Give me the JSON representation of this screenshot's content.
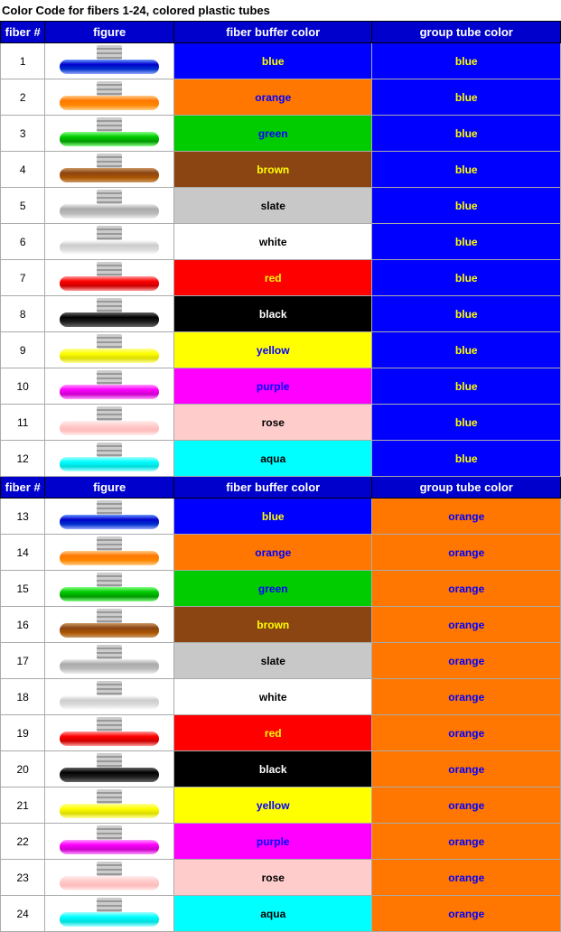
{
  "title": "Color Code for fibers 1-24, colored plastic tubes",
  "headers": {
    "fiber": "fiber #",
    "figure": "figure",
    "buffer": "fiber buffer color",
    "group": "group tube color"
  },
  "fibers": [
    {
      "num": 1,
      "figClass": "fig-blue",
      "bufferLabel": "blue",
      "bufferClass": "bg-blue",
      "groupLabel": "blue",
      "groupClass": "group-blue"
    },
    {
      "num": 2,
      "figClass": "fig-orange",
      "bufferLabel": "orange",
      "bufferClass": "bg-orange",
      "groupLabel": "blue",
      "groupClass": "group-blue"
    },
    {
      "num": 3,
      "figClass": "fig-green",
      "bufferLabel": "green",
      "bufferClass": "bg-green",
      "groupLabel": "blue",
      "groupClass": "group-blue"
    },
    {
      "num": 4,
      "figClass": "fig-brown",
      "bufferLabel": "brown",
      "bufferClass": "bg-brown",
      "groupLabel": "blue",
      "groupClass": "group-blue"
    },
    {
      "num": 5,
      "figClass": "fig-slate",
      "bufferLabel": "slate",
      "bufferClass": "bg-slate",
      "groupLabel": "blue",
      "groupClass": "group-blue"
    },
    {
      "num": 6,
      "figClass": "fig-white",
      "bufferLabel": "white",
      "bufferClass": "bg-white",
      "groupLabel": "blue",
      "groupClass": "group-blue"
    },
    {
      "num": 7,
      "figClass": "fig-red",
      "bufferLabel": "red",
      "bufferClass": "bg-red",
      "groupLabel": "blue",
      "groupClass": "group-blue"
    },
    {
      "num": 8,
      "figClass": "fig-black",
      "bufferLabel": "black",
      "bufferClass": "bg-black",
      "groupLabel": "blue",
      "groupClass": "group-blue"
    },
    {
      "num": 9,
      "figClass": "fig-yellow",
      "bufferLabel": "yellow",
      "bufferClass": "bg-yellow",
      "groupLabel": "blue",
      "groupClass": "group-blue"
    },
    {
      "num": 10,
      "figClass": "fig-purple",
      "bufferLabel": "purple",
      "bufferClass": "bg-purple",
      "groupLabel": "blue",
      "groupClass": "group-blue"
    },
    {
      "num": 11,
      "figClass": "fig-rose",
      "bufferLabel": "rose",
      "bufferClass": "bg-rose",
      "groupLabel": "blue",
      "groupClass": "group-blue"
    },
    {
      "num": 12,
      "figClass": "fig-aqua",
      "bufferLabel": "aqua",
      "bufferClass": "bg-aqua",
      "groupLabel": "blue",
      "groupClass": "group-blue"
    },
    {
      "num": 13,
      "figClass": "fig-blue",
      "bufferLabel": "blue",
      "bufferClass": "bg-blue",
      "groupLabel": "orange",
      "groupClass": "group-orange"
    },
    {
      "num": 14,
      "figClass": "fig-orange",
      "bufferLabel": "orange",
      "bufferClass": "bg-orange",
      "groupLabel": "orange",
      "groupClass": "group-orange"
    },
    {
      "num": 15,
      "figClass": "fig-green",
      "bufferLabel": "green",
      "bufferClass": "bg-green",
      "groupLabel": "orange",
      "groupClass": "group-orange"
    },
    {
      "num": 16,
      "figClass": "fig-brown",
      "bufferLabel": "brown",
      "bufferClass": "bg-brown",
      "groupLabel": "orange",
      "groupClass": "group-orange"
    },
    {
      "num": 17,
      "figClass": "fig-slate",
      "bufferLabel": "slate",
      "bufferClass": "bg-slate",
      "groupLabel": "orange",
      "groupClass": "group-orange"
    },
    {
      "num": 18,
      "figClass": "fig-white",
      "bufferLabel": "white",
      "bufferClass": "bg-white",
      "groupLabel": "orange",
      "groupClass": "group-orange"
    },
    {
      "num": 19,
      "figClass": "fig-red",
      "bufferLabel": "red",
      "bufferClass": "bg-red",
      "groupLabel": "orange",
      "groupClass": "group-orange"
    },
    {
      "num": 20,
      "figClass": "fig-black",
      "bufferLabel": "black",
      "bufferClass": "bg-black",
      "groupLabel": "orange",
      "groupClass": "group-orange"
    },
    {
      "num": 21,
      "figClass": "fig-yellow",
      "bufferLabel": "yellow",
      "bufferClass": "bg-yellow",
      "groupLabel": "orange",
      "groupClass": "group-orange"
    },
    {
      "num": 22,
      "figClass": "fig-purple",
      "bufferLabel": "purple",
      "bufferClass": "bg-purple",
      "groupLabel": "orange",
      "groupClass": "group-orange"
    },
    {
      "num": 23,
      "figClass": "fig-rose",
      "bufferLabel": "rose",
      "bufferClass": "bg-rose",
      "groupLabel": "orange",
      "groupClass": "group-orange"
    },
    {
      "num": 24,
      "figClass": "fig-aqua",
      "bufferLabel": "aqua",
      "bufferClass": "bg-aqua",
      "groupLabel": "orange",
      "groupClass": "group-orange"
    }
  ]
}
